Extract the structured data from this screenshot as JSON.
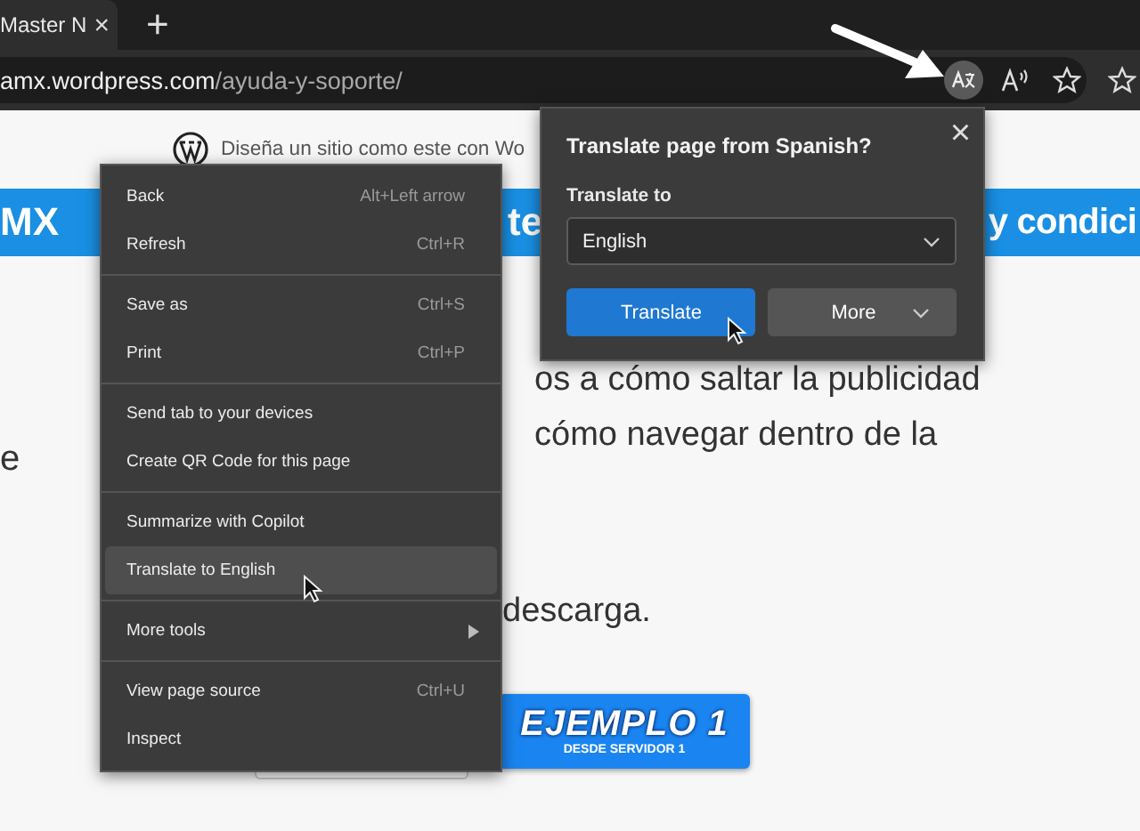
{
  "tab": {
    "title": "Master N",
    "close": "×"
  },
  "new_tab": "+",
  "address_bar": {
    "domain": "amx.wordpress.com",
    "path": "/ayuda-y-soporte/"
  },
  "toolbar_icons": [
    {
      "kind": "translate",
      "selected": true
    },
    {
      "kind": "read_aloud",
      "selected": false
    },
    {
      "kind": "favorite",
      "selected": false
    },
    {
      "kind": "favorites",
      "selected": false
    }
  ],
  "page": {
    "site_banner": "Diseña un sitio como este con Wo",
    "header_segments": [
      "MX",
      "te",
      "y condici"
    ],
    "paragraph_lines": [
      "os a cómo saltar la publicidad",
      "cómo navegar dentro de la"
    ],
    "left_fragment": "e",
    "closing_line": "descarga.",
    "image_button": {
      "title": "EJEMPLO 1",
      "subtitle": "DESDE SERVIDOR 1"
    }
  },
  "context_menu": {
    "groups": [
      [
        {
          "label": "Back",
          "shortcut": "Alt+Left arrow",
          "highlighted": false,
          "kind": "command"
        },
        {
          "label": "Refresh",
          "shortcut": "Ctrl+R",
          "highlighted": false,
          "kind": "command"
        }
      ],
      [
        {
          "label": "Save as",
          "shortcut": "Ctrl+S",
          "highlighted": false,
          "kind": "command"
        },
        {
          "label": "Print",
          "shortcut": "Ctrl+P",
          "highlighted": false,
          "kind": "command"
        }
      ],
      [
        {
          "label": "Send tab to your devices",
          "highlighted": false,
          "kind": "command"
        },
        {
          "label": "Create QR Code for this page",
          "highlighted": false,
          "kind": "command"
        }
      ],
      [
        {
          "label": "Summarize with Copilot",
          "highlighted": false,
          "kind": "command"
        },
        {
          "label": "Translate to English",
          "highlighted": true,
          "kind": "command"
        }
      ],
      [
        {
          "label": "More tools",
          "highlighted": false,
          "kind": "submenu"
        }
      ],
      [
        {
          "label": "View page source",
          "shortcut": "Ctrl+U",
          "highlighted": false,
          "kind": "command"
        },
        {
          "label": "Inspect",
          "highlighted": false,
          "kind": "command"
        }
      ]
    ]
  },
  "translate_popup": {
    "title": "Translate page from Spanish?",
    "close": "×",
    "label": "Translate to",
    "language": "English",
    "buttons": [
      {
        "label": "Translate",
        "kind": "primary"
      },
      {
        "label": "More",
        "kind": "dropdown"
      }
    ]
  }
}
